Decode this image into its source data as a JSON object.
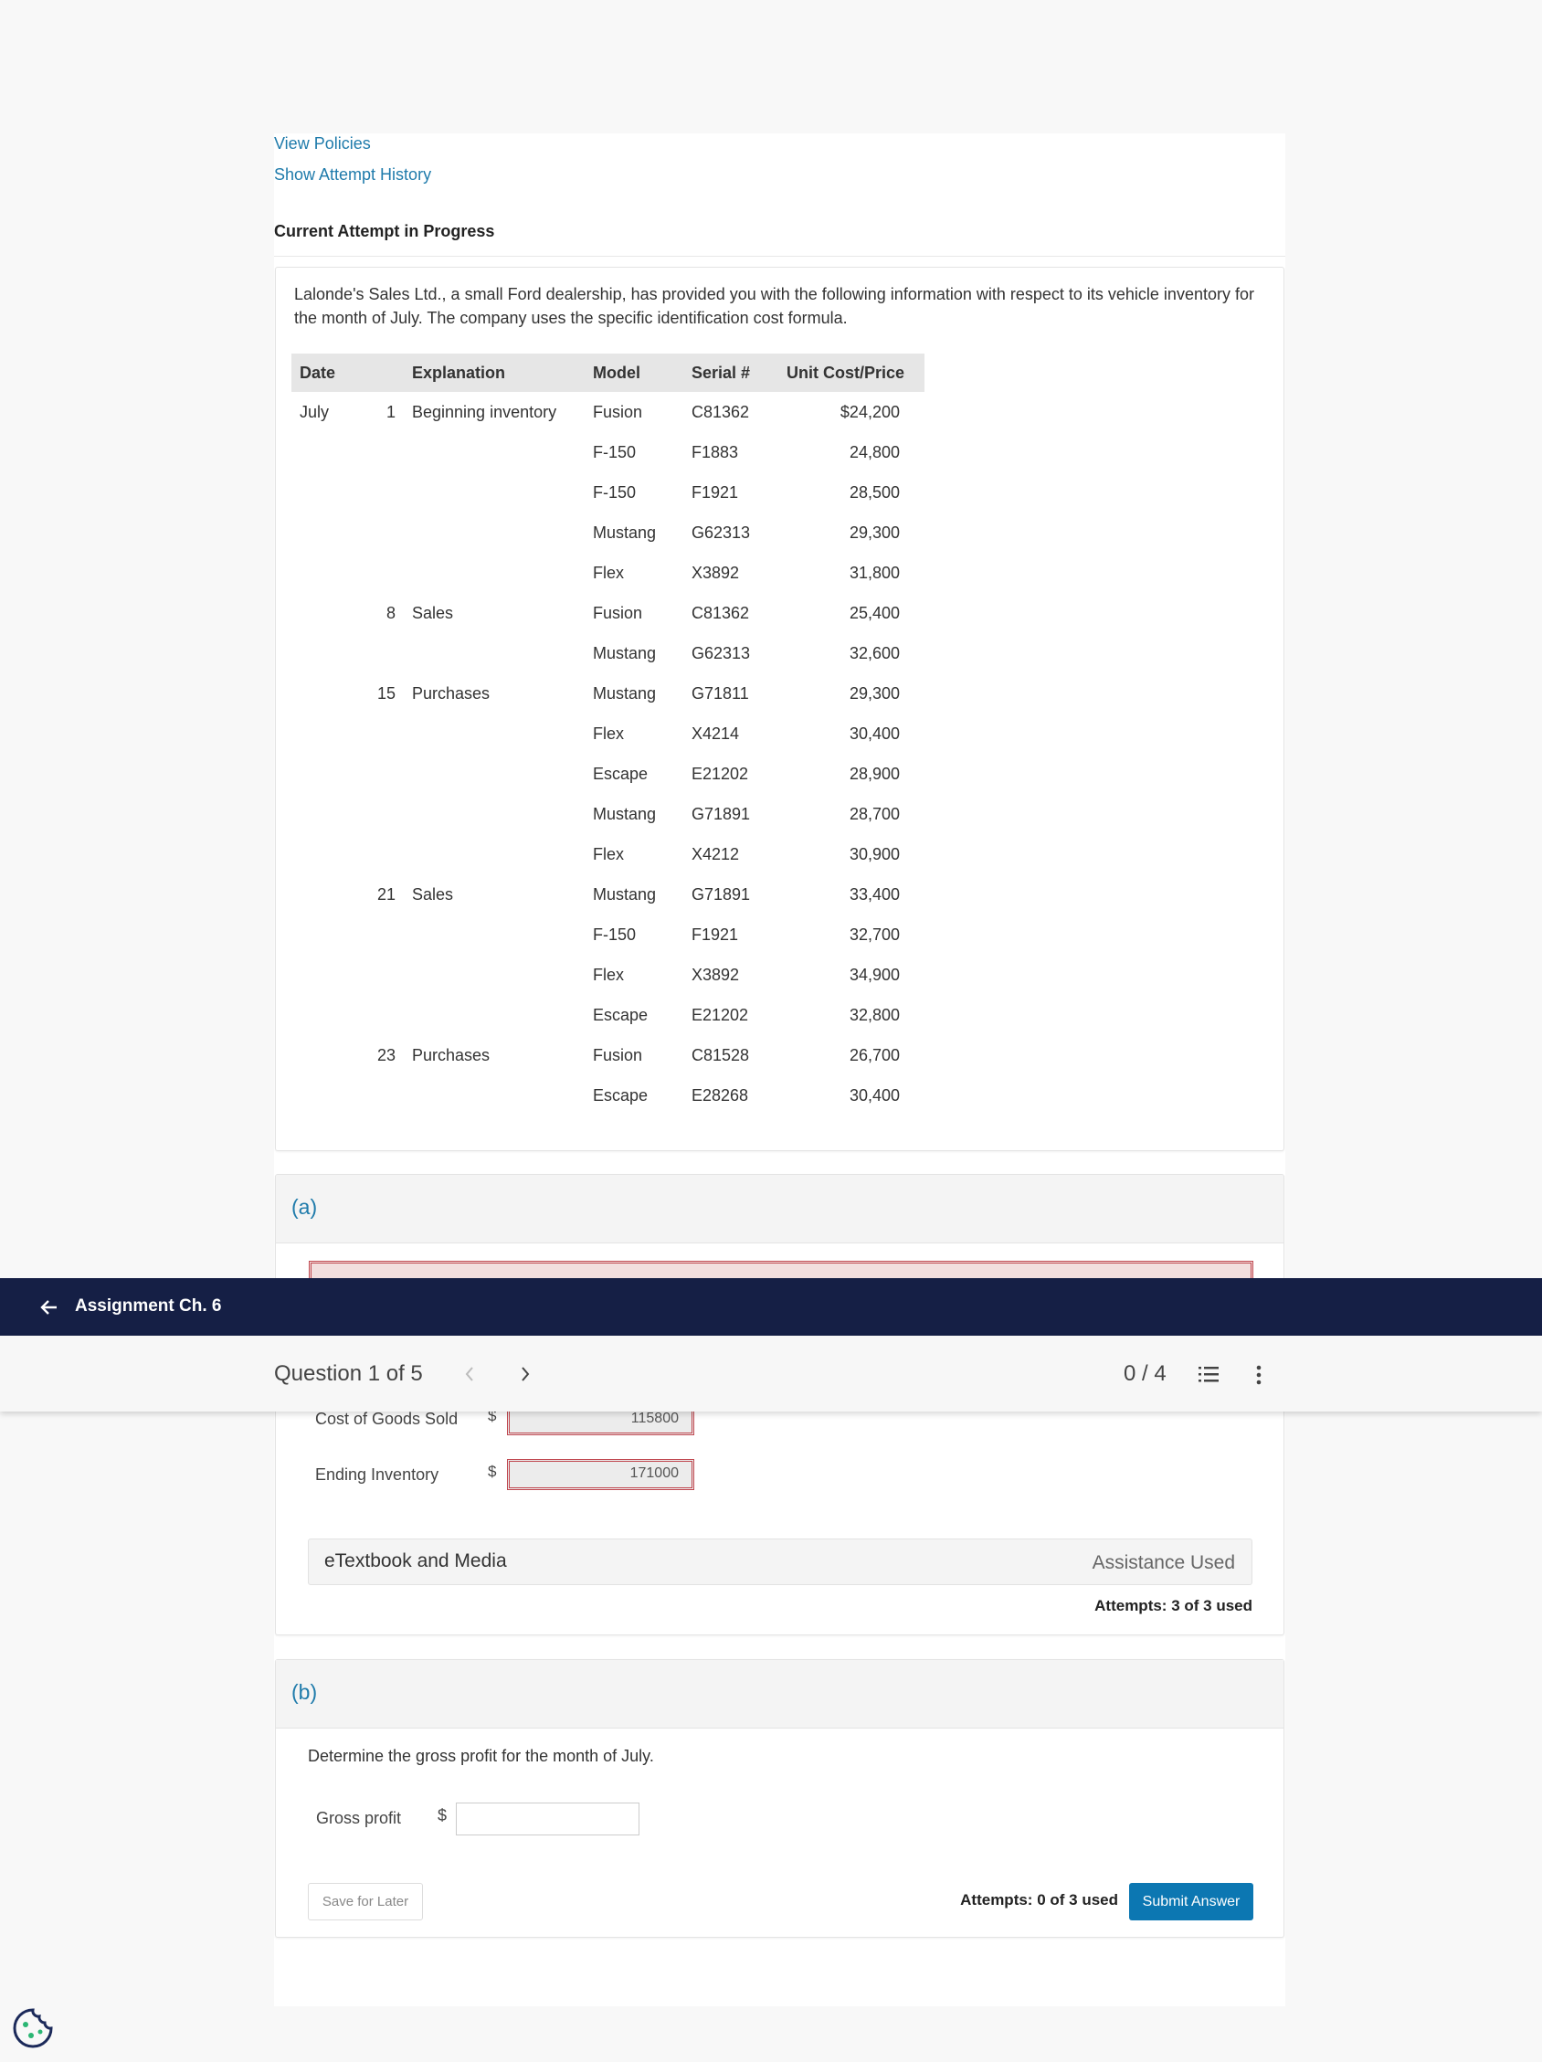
{
  "links": {
    "view_policies": "View Policies",
    "attempt_history": "Show Attempt History"
  },
  "attempt_heading": "Current Attempt in Progress",
  "problem": {
    "intro": "Lalonde's Sales Ltd., a small Ford dealership, has provided you with the following information with respect to its vehicle inventory for the month of July. The company uses the specific identification cost formula.",
    "columns": [
      "Date",
      "Explanation",
      "Model",
      "Serial #",
      "Unit Cost/Price"
    ],
    "rows": [
      {
        "month": "July",
        "day": "1",
        "explanation": "Beginning inventory",
        "model": "Fusion",
        "serial": "C81362",
        "cost": "$24,200"
      },
      {
        "month": "",
        "day": "",
        "explanation": "",
        "model": "F-150",
        "serial": "F1883",
        "cost": "24,800"
      },
      {
        "month": "",
        "day": "",
        "explanation": "",
        "model": "F-150",
        "serial": "F1921",
        "cost": "28,500"
      },
      {
        "month": "",
        "day": "",
        "explanation": "",
        "model": "Mustang",
        "serial": "G62313",
        "cost": "29,300"
      },
      {
        "month": "",
        "day": "",
        "explanation": "",
        "model": "Flex",
        "serial": "X3892",
        "cost": "31,800"
      },
      {
        "month": "",
        "day": "8",
        "explanation": "Sales",
        "model": "Fusion",
        "serial": "C81362",
        "cost": "25,400"
      },
      {
        "month": "",
        "day": "",
        "explanation": "",
        "model": "Mustang",
        "serial": "G62313",
        "cost": "32,600"
      },
      {
        "month": "",
        "day": "15",
        "explanation": "Purchases",
        "model": "Mustang",
        "serial": "G71811",
        "cost": "29,300"
      },
      {
        "month": "",
        "day": "",
        "explanation": "",
        "model": "Flex",
        "serial": "X4214",
        "cost": "30,400"
      },
      {
        "month": "",
        "day": "",
        "explanation": "",
        "model": "Escape",
        "serial": "E21202",
        "cost": "28,900"
      },
      {
        "month": "",
        "day": "",
        "explanation": "",
        "model": "Mustang",
        "serial": "G71891",
        "cost": "28,700"
      },
      {
        "month": "",
        "day": "",
        "explanation": "",
        "model": "Flex",
        "serial": "X4212",
        "cost": "30,900"
      },
      {
        "month": "",
        "day": "21",
        "explanation": "Sales",
        "model": "Mustang",
        "serial": "G71891",
        "cost": "33,400"
      },
      {
        "month": "",
        "day": "",
        "explanation": "",
        "model": "F-150",
        "serial": "F1921",
        "cost": "32,700"
      },
      {
        "month": "",
        "day": "",
        "explanation": "",
        "model": "Flex",
        "serial": "X3892",
        "cost": "34,900"
      },
      {
        "month": "",
        "day": "",
        "explanation": "",
        "model": "Escape",
        "serial": "E21202",
        "cost": "32,800"
      },
      {
        "month": "",
        "day": "23",
        "explanation": "Purchases",
        "model": "Fusion",
        "serial": "C81528",
        "cost": "26,700"
      },
      {
        "month": "",
        "day": "",
        "explanation": "",
        "model": "Escape",
        "serial": "E28268",
        "cost": "30,400"
      }
    ]
  },
  "part_a": {
    "label": "(a)",
    "cogs_label": "Cost of Goods Sold",
    "cogs_currency": "$",
    "cogs_value": "115800",
    "ending_label": "Ending Inventory",
    "ending_currency": "$",
    "ending_value": "171000",
    "etextbook": "eTextbook and Media",
    "assistance": "Assistance Used",
    "attempts": "Attempts: 3 of 3 used"
  },
  "part_b": {
    "label": "(b)",
    "prompt": "Determine the gross profit for the month of July.",
    "gross_label": "Gross profit",
    "gross_currency": "$",
    "gross_value": "",
    "save": "Save for Later",
    "attempts": "Attempts: 0 of 3 used",
    "submit": "Submit Answer"
  },
  "nav": {
    "back_title": "Assignment Ch. 6",
    "question": "Question 1 of 5",
    "score": "0 / 4"
  },
  "colors": {
    "navy": "#151f45",
    "link": "#1f7bab",
    "submit": "#0c77b2",
    "error": "#c0474f"
  },
  "icons": [
    "arrow-left-icon",
    "chevron-left-icon",
    "chevron-right-icon",
    "list-icon",
    "more-vertical-icon",
    "cookie-icon"
  ]
}
